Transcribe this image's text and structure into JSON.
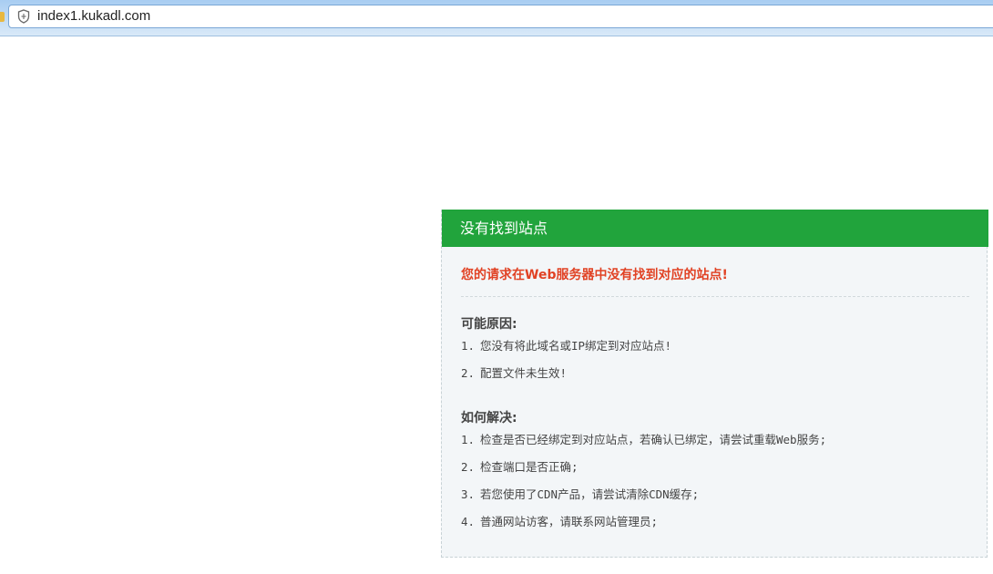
{
  "browser": {
    "url": "index1.kukadl.com",
    "shield_icon": "shield-icon"
  },
  "panel": {
    "header_title": "没有找到站点",
    "error_message": "您的请求在Web服务器中没有找到对应的站点!",
    "reasons": {
      "title": "可能原因:",
      "items": [
        {
          "num": "1.",
          "text": "您没有将此域名或IP绑定到对应站点!"
        },
        {
          "num": "2.",
          "text": "配置文件未生效!"
        }
      ]
    },
    "solutions": {
      "title": "如何解决:",
      "items": [
        {
          "num": "1.",
          "text": "检查是否已经绑定到对应站点，若确认已绑定，请尝试重载Web服务;"
        },
        {
          "num": "2.",
          "text": "检查端口是否正确;"
        },
        {
          "num": "3.",
          "text": "若您使用了CDN产品，请尝试清除CDN缓存;"
        },
        {
          "num": "4.",
          "text": "普通网站访客，请联系网站管理员;"
        }
      ]
    },
    "colors": {
      "header_bg": "#21a43c",
      "error_text": "#e14224",
      "panel_bg": "#f3f6f8"
    }
  }
}
